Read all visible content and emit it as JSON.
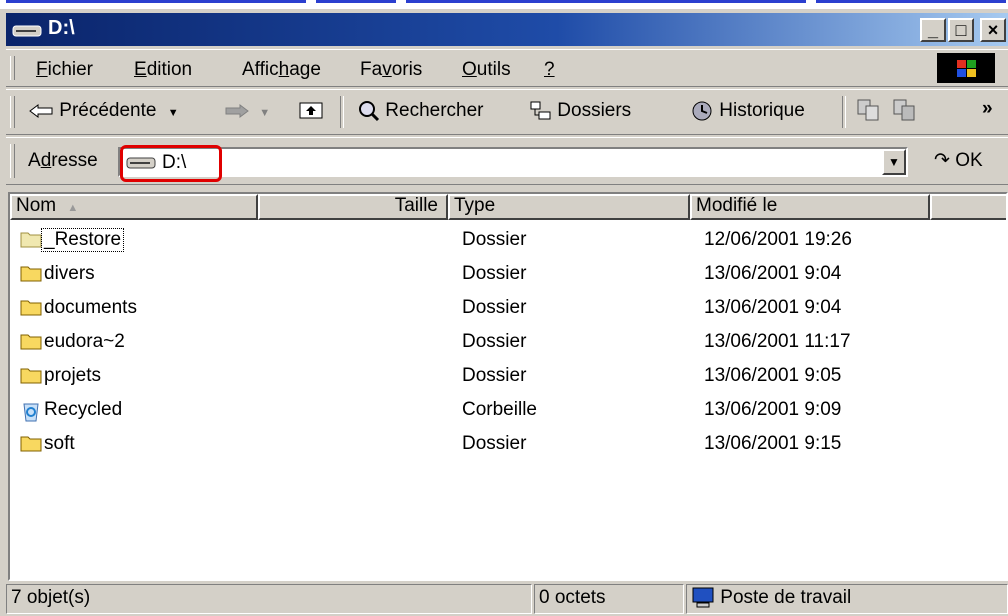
{
  "window": {
    "title": "D:\\"
  },
  "menu": [
    "Fichier",
    "Edition",
    "Affichage",
    "Favoris",
    "Outils",
    "?"
  ],
  "toolbar": {
    "back": "Précédente",
    "search": "Rechercher",
    "folders": "Dossiers",
    "history": "Historique",
    "overflow": "»"
  },
  "address": {
    "label": "Adresse",
    "value": "D:\\",
    "go": "OK"
  },
  "columns": {
    "name": "Nom",
    "size": "Taille",
    "type": "Type",
    "modified": "Modifié le"
  },
  "files": [
    {
      "name": "_Restore",
      "type": "Dossier",
      "modified": "12/06/2001 19:26",
      "icon": "folder-open-icon"
    },
    {
      "name": "divers",
      "type": "Dossier",
      "modified": "13/06/2001 9:04",
      "icon": "folder-icon"
    },
    {
      "name": "documents",
      "type": "Dossier",
      "modified": "13/06/2001 9:04",
      "icon": "folder-icon"
    },
    {
      "name": "eudora~2",
      "type": "Dossier",
      "modified": "13/06/2001 11:17",
      "icon": "folder-icon"
    },
    {
      "name": "projets",
      "type": "Dossier",
      "modified": "13/06/2001 9:05",
      "icon": "folder-icon"
    },
    {
      "name": "Recycled",
      "type": "Corbeille",
      "modified": "13/06/2001 9:09",
      "icon": "recycle-bin-icon"
    },
    {
      "name": "soft",
      "type": "Dossier",
      "modified": "13/06/2001 9:15",
      "icon": "folder-icon"
    }
  ],
  "status": {
    "count": "7 objet(s)",
    "size": "0 octets",
    "location": "Poste de travail"
  },
  "colors": {
    "title_start": "#0a246a",
    "title_end": "#a6caf0",
    "face": "#d4d0c8",
    "highlight_box": "#e00000"
  }
}
